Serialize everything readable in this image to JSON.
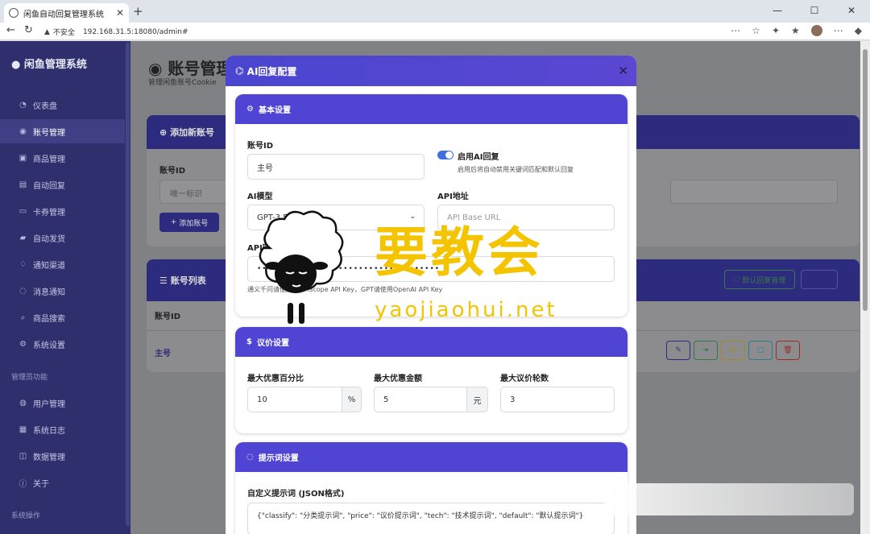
{
  "browser": {
    "tab_title": "闲鱼自动回复管理系统",
    "security": "不安全",
    "url": "192.168.31.5:18080/admin#"
  },
  "sidebar": {
    "brand": "闲鱼管理系统",
    "items": [
      {
        "label": "仪表盘",
        "icon": "dashboard-icon"
      },
      {
        "label": "账号管理",
        "icon": "user-circle-icon"
      },
      {
        "label": "商品管理",
        "icon": "box-icon"
      },
      {
        "label": "自动回复",
        "icon": "chat-icon"
      },
      {
        "label": "卡券管理",
        "icon": "card-icon"
      },
      {
        "label": "自动发货",
        "icon": "truck-icon"
      },
      {
        "label": "通知渠道",
        "icon": "bell-icon"
      },
      {
        "label": "消息通知",
        "icon": "message-icon"
      },
      {
        "label": "商品搜索",
        "icon": "search-icon"
      },
      {
        "label": "系统设置",
        "icon": "gear-icon"
      }
    ],
    "admin_section": "管理员功能",
    "admin_items": [
      {
        "label": "用户管理",
        "icon": "users-icon"
      },
      {
        "label": "系统日志",
        "icon": "log-icon"
      },
      {
        "label": "数据管理",
        "icon": "database-icon"
      },
      {
        "label": "关于",
        "icon": "info-icon"
      }
    ],
    "ops_section": "系统操作"
  },
  "page": {
    "title": "账号管理",
    "subtitle": "管理闲鱼账号Cookie",
    "add_card_title": "添加新账号",
    "account_id_label": "账号ID",
    "account_id_placeholder": "唯一标识",
    "add_button": "添加账号",
    "list_title": "账号列表",
    "default_reply_button": "默认回复管理",
    "column_account_id": "账号ID",
    "row_account": "主号"
  },
  "modal": {
    "title": "AI回复配置",
    "basic": {
      "title": "基本设置",
      "account_id_label": "账号ID",
      "account_id_value": "主号",
      "enable_label": "启用AI回复",
      "enable_on": true,
      "enable_hint": "启用后将自动禁用关键词匹配和默认回复",
      "model_label": "AI模型",
      "model_value": "GPT-3.5 Turbo",
      "api_url_label": "API地址",
      "api_url_placeholder": "API Base URL",
      "api_key_label": "API密钥",
      "api_key_required": "*",
      "api_key_value": "••••••••••••••••••••••••••••••••••••",
      "api_key_hint": "通义千问请使用DashScope API Key，GPT请使用OpenAI API Key"
    },
    "bargain": {
      "title": "议价设置",
      "max_pct_label": "最大优惠百分比",
      "max_pct_value": "10",
      "max_pct_unit": "%",
      "max_amount_label": "最大优惠金额",
      "max_amount_value": "5",
      "max_amount_unit": "元",
      "max_rounds_label": "最大议价轮数",
      "max_rounds_value": "3"
    },
    "prompt": {
      "title": "提示词设置",
      "custom_label": "自定义提示词 (JSON格式)",
      "custom_value": "{\"classify\": \"分类提示词\", \"price\": \"议价提示词\", \"tech\": \"技术提示词\", \"default\": \"默认提示词\"}"
    }
  },
  "watermark": {
    "text": "要教会",
    "url": "yaojiaohui.net"
  }
}
